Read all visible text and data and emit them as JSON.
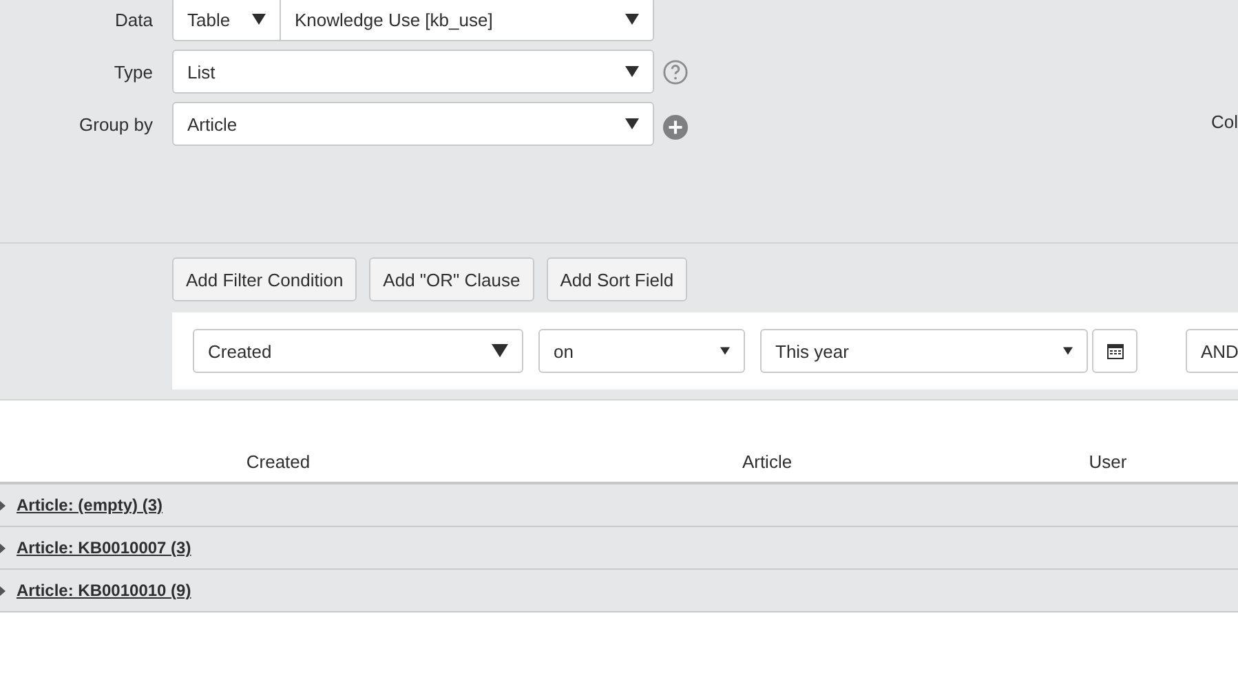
{
  "form": {
    "data": {
      "label": "Data",
      "source_type": "Table",
      "table": "Knowledge Use [kb_use]"
    },
    "type": {
      "label": "Type",
      "value": "List"
    },
    "group_by": {
      "label": "Group by",
      "value": "Article"
    },
    "side_label": "Col"
  },
  "filter_buttons": [
    "Add Filter Condition",
    "Add \"OR\" Clause",
    "Add Sort Field"
  ],
  "condition": {
    "field": "Created",
    "operator": "on",
    "value": "This year",
    "conjunction": "AND"
  },
  "table": {
    "columns": [
      "Created",
      "Article",
      "User"
    ],
    "groups": [
      {
        "label": "Article: (empty) (3)",
        "expanded": false
      },
      {
        "label": "Article: KB0010007 (3)",
        "expanded": false
      },
      {
        "label": "Article: KB0010010 (9)",
        "expanded": false
      }
    ]
  }
}
